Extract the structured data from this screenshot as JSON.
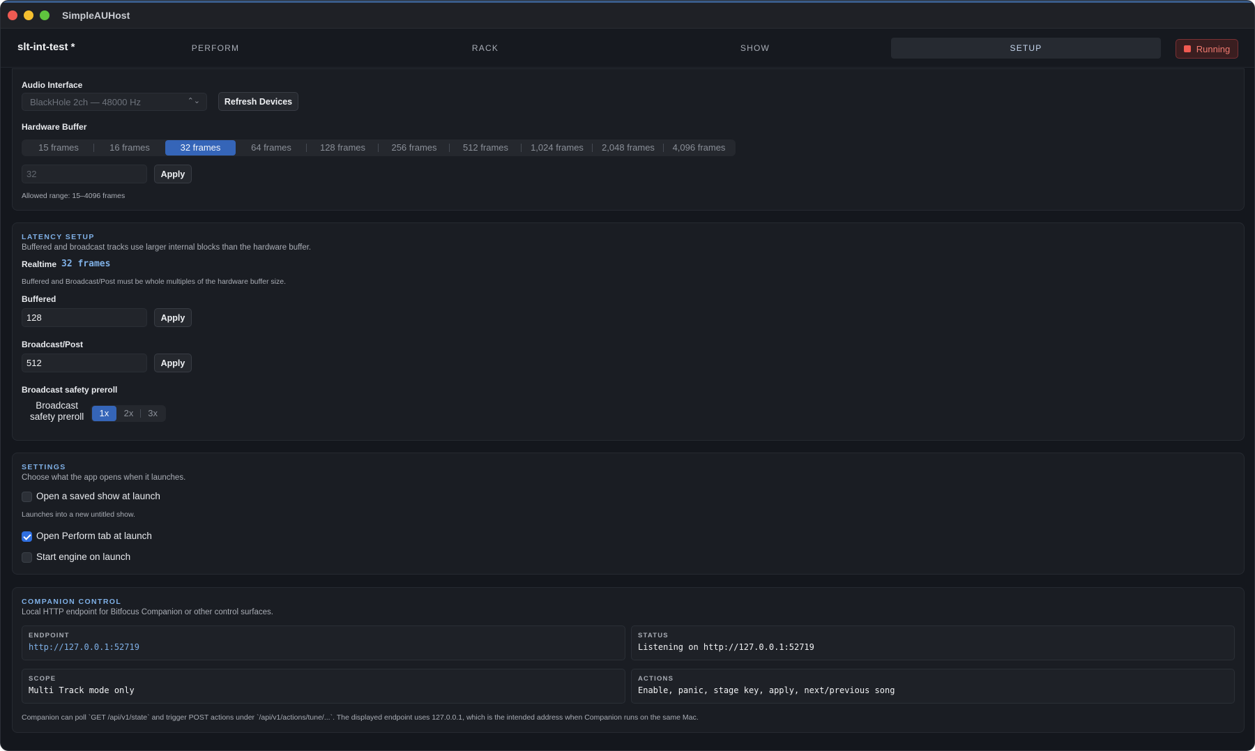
{
  "window": {
    "title": "SimpleAUHost"
  },
  "header": {
    "document_name": "slt-int-test *",
    "tabs": [
      {
        "label": "PERFORM",
        "active": false
      },
      {
        "label": "RACK",
        "active": false
      },
      {
        "label": "SHOW",
        "active": false
      },
      {
        "label": "SETUP",
        "active": true
      }
    ],
    "status_button": {
      "label": "Running",
      "icon": "stop-icon",
      "color": "#f05a52"
    }
  },
  "audio": {
    "interface_label": "Audio Interface",
    "device_select": {
      "value": "BlackHole 2ch — 48000 Hz"
    },
    "refresh_label": "Refresh Devices",
    "buffer_label": "Hardware Buffer",
    "buffer_options": [
      "15 frames",
      "16 frames",
      "32 frames",
      "64 frames",
      "128 frames",
      "256 frames",
      "512 frames",
      "1,024 frames",
      "2,048 frames",
      "4,096 frames"
    ],
    "buffer_selected": "32 frames",
    "buffer_input": {
      "value": "32"
    },
    "apply_label": "Apply",
    "range_hint": "Allowed range: 15–4096 frames"
  },
  "latency": {
    "heading": "LATENCY SETUP",
    "description": "Buffered and broadcast tracks use larger internal blocks than the hardware buffer.",
    "realtime_label": "Realtime",
    "realtime_value": "32 frames",
    "multiple_hint": "Buffered and Broadcast/Post must be whole multiples of the hardware buffer size.",
    "buffered_label": "Buffered",
    "buffered_value": "128",
    "broadcast_label": "Broadcast/Post",
    "broadcast_value": "512",
    "apply_label": "Apply",
    "preroll_label": "Broadcast safety preroll",
    "preroll_inline_label_1": "Broadcast",
    "preroll_inline_label_2": "safety preroll",
    "preroll_options": [
      "1x",
      "2x",
      "3x"
    ],
    "preroll_selected": "1x"
  },
  "settings": {
    "heading": "SETTINGS",
    "description": "Choose what the app opens when it launches.",
    "open_saved_show": {
      "label": "Open a saved show at launch",
      "checked": false
    },
    "open_saved_hint": "Launches into a new untitled show.",
    "open_perform": {
      "label": "Open Perform tab at launch",
      "checked": true
    },
    "start_engine": {
      "label": "Start engine on launch",
      "checked": false
    }
  },
  "companion": {
    "heading": "COMPANION CONTROL",
    "description": "Local HTTP endpoint for Bitfocus Companion or other control surfaces.",
    "endpoint_head": "ENDPOINT",
    "endpoint_value": "http://127.0.0.1:52719",
    "status_head": "STATUS",
    "status_value": "Listening on http://127.0.0.1:52719",
    "scope_head": "SCOPE",
    "scope_value": "Multi Track mode only",
    "actions_head": "ACTIONS",
    "actions_value": "Enable, panic, stage key, apply, next/previous song",
    "footnote": "Companion can poll `GET /api/v1/state` and trigger POST actions under `/api/v1/actions/tune/...`. The displayed endpoint uses 127.0.0.1, which is the intended address when Companion runs on the same Mac."
  },
  "colors": {
    "accent": "#3565b8",
    "section_heading": "#7fb0e6",
    "background": "#14171d"
  }
}
